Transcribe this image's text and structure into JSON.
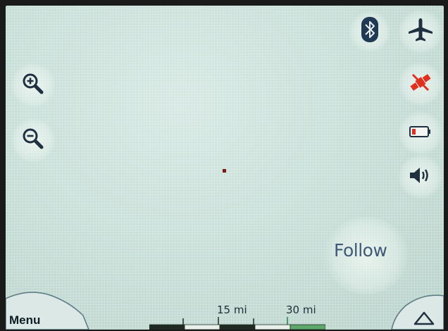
{
  "map": {
    "follow_label": "Follow",
    "menu_label": "Menu",
    "scale": {
      "labels": [
        "15 mi",
        "30 mi"
      ],
      "segment_colors": [
        "#1f2a22",
        "#e9f0ec",
        "#1f2a22",
        "#e9f0ec",
        "#5da86a"
      ]
    }
  },
  "controls": {
    "left": [
      {
        "name": "zoom-in-icon"
      },
      {
        "name": "zoom-out-icon"
      }
    ],
    "right": [
      {
        "name": "bluetooth-icon"
      },
      {
        "name": "airplane-icon"
      },
      {
        "name": "gps-off-icon"
      },
      {
        "name": "battery-low-icon"
      },
      {
        "name": "volume-icon"
      }
    ]
  },
  "colors": {
    "map_background": "#c9dfd9",
    "icon_dark": "#1f3040",
    "alert_red": "#e0301e",
    "follow_text": "#3e5a78"
  }
}
